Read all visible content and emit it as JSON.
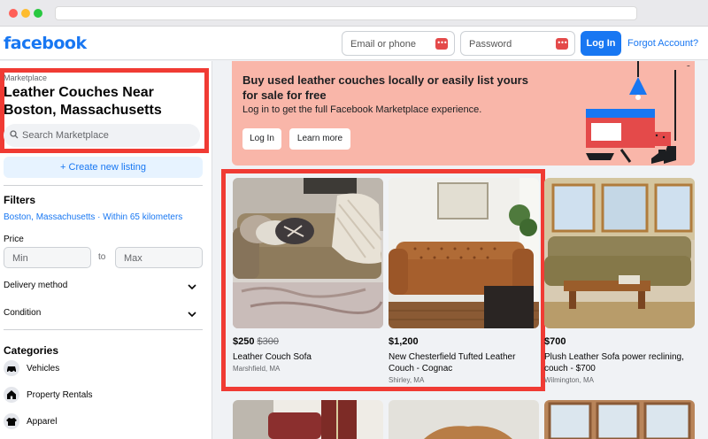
{
  "header": {
    "logo": "facebook",
    "email_placeholder": "Email or phone",
    "password_placeholder": "Password",
    "login_button": "Log In",
    "forgot_link": "Forgot Account?",
    "key_badge": "•••"
  },
  "sidebar": {
    "section_label": "Marketplace",
    "title": "Leather Couches Near Boston, Massachusetts",
    "search_placeholder": "Search Marketplace",
    "create_listing": "+ Create new listing",
    "filters_heading": "Filters",
    "location_link": "Boston, Massachusetts · Within 65 kilometers",
    "price_label": "Price",
    "min_placeholder": "Min",
    "to_text": "to",
    "max_placeholder": "Max",
    "delivery_label": "Delivery method",
    "condition_label": "Condition",
    "categories_heading": "Categories",
    "categories": [
      {
        "label": "Vehicles",
        "icon": "car-icon"
      },
      {
        "label": "Property Rentals",
        "icon": "house-icon"
      },
      {
        "label": "Apparel",
        "icon": "shirt-icon"
      }
    ]
  },
  "banner": {
    "title": "Buy used leather couches locally or easily list yours for sale for free",
    "subtitle": "Log in to get the full Facebook Marketplace experience.",
    "login_button": "Log In",
    "learn_more_button": "Learn more"
  },
  "listings": [
    {
      "price": "$250",
      "old_price": "$300",
      "title": "Leather Couch Sofa",
      "location": "Marshfield, MA"
    },
    {
      "price": "$1,200",
      "old_price": "",
      "title": "New Chesterfield Tufted Leather Couch - Cognac",
      "location": "Shirley, MA"
    },
    {
      "price": "$700",
      "old_price": "",
      "title": "Plush Leather Sofa power reclining, couch - $700",
      "location": "Wilmington, MA"
    }
  ],
  "colors": {
    "brand": "#1877f2",
    "highlight": "#f03b34",
    "banner": "#f9b6a9"
  }
}
